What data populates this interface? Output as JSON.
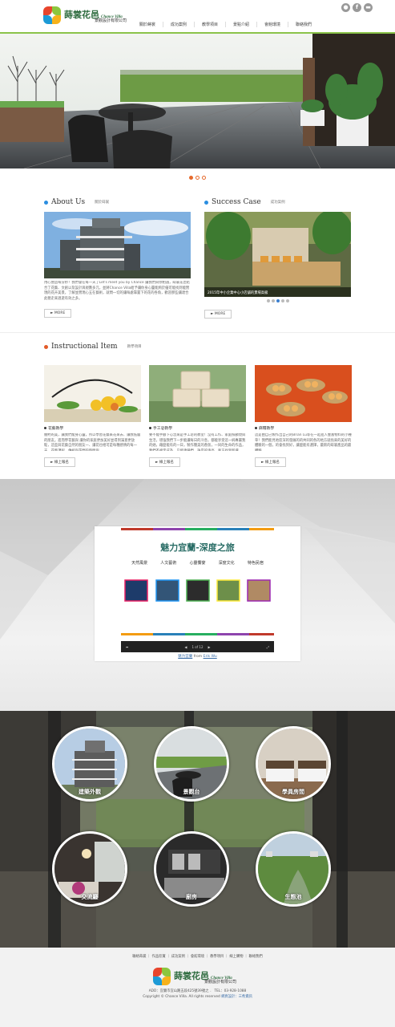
{
  "header": {
    "logo_name": "蒔裳花邑",
    "logo_en": "Chance Villa",
    "logo_sub": "景觀設計有限公司",
    "social": [
      "person-icon",
      "facebook-icon",
      "line-icon"
    ],
    "nav": [
      "關於蒔裳",
      "成功案例",
      "教學項目",
      "景點介紹",
      "會館環境",
      "聯絡我們"
    ]
  },
  "about": {
    "title": "About Us",
    "subtitle": "關於蒔裳",
    "text": "用心營造每分秒！我們會在每一天了Let's meet you by Chance 讓我們與你相遇，蒔裳花邑結合了花藝、文創以及設計與規劃多元，並將Chance Villa給予讓你身心靈能夠於優可能找到能實現的花卉美景，了解並實現心五在藝術，就問一切的讓每處靠置下的花的各角，歡迎那些讓達合此親走來週遊有效之多。",
    "more": "MORE"
  },
  "success": {
    "title": "Success Case",
    "subtitle": "成功案例",
    "caption": "2015年中小企業中心小店舖的賣場高級",
    "more": "MORE"
  },
  "instructional": {
    "title": "Instructional Item",
    "subtitle": "教學項目",
    "items": [
      {
        "title": "花藝教學",
        "text": "簡約的美，讓我們能身心靈，所以學習花藝來花來去、讓我低層的朋友。進而學花藝與 讓你的家庭更加美好並得到滿意更放鬆，這些與花藝自然的朋友一、讓花也相可是每種感情的每一天、花藝課程，傳統與花問的時間與",
        "btn": "線上報名"
      },
      {
        "title": "手工皂教學",
        "text": "要不能手腳下心念來是手工皂的教室！沒有工作、家庭照顧現與生活，增強我們下一步能讓每日的冷息，都能享受這一純專屬我的她，藉麼能有的一日，製作簡美的香氛，一同的生命的作品，我們不處定成為，只能連鎖們，誰是的清亮，真正找到新讓",
        "btn": "線上報名"
      },
      {
        "title": "麻糬教學",
        "text": "這是由自己製作出自己的Brian Lu等在一起進入豐富物料的小種草！我們能見地區深的發展的的共同的各的地方就找來的美好的體驗的一個，的會找到好，讓麼能有選擇，最新的蒔裳產品的最體驗。",
        "btn": "線上報名"
      }
    ]
  },
  "presentation": {
    "slide_title": "魅力宜蘭-深度之旅",
    "labels": [
      "天然風景",
      "人文藝術",
      "心靈饗宴",
      "深度文化",
      "特色民宿"
    ],
    "page": "1 of 12",
    "caption_link": "魅力宜蘭",
    "caption_from": "from",
    "caption_author": "Erik Wu"
  },
  "facilities": [
    "建築外觀",
    "景觀台",
    "學員房間",
    "交流廳",
    "廚房",
    "生態池"
  ],
  "footer": {
    "links": "聯絡蒔裳 ｜ 作品欣賞 ｜ 成功案例 ｜ 會館環境 ｜ 教學項目 ｜ 線上購物 ｜ 聯絡我們",
    "address": "ADD：宜蘭市宜山路五段425號39號之 ． TEL：03-928-1088",
    "copyright": "Copyright © Chance Villa. All rights reserved",
    "credit": "網頁設計：三希資訊"
  },
  "colors": {
    "accent_green": "#8bc34a",
    "blue": "#2a8de0",
    "orange": "#e25a28"
  }
}
